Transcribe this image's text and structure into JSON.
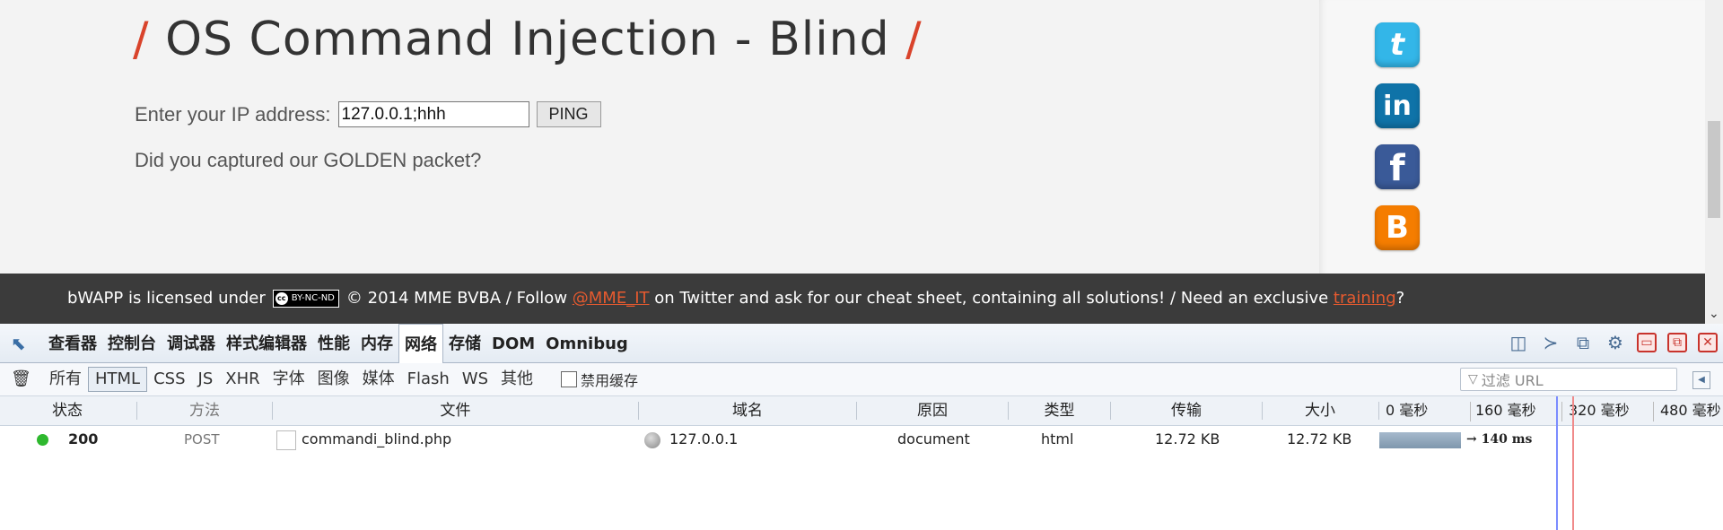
{
  "page": {
    "title": "OS Command Injection - Blind",
    "title_slash": "/",
    "ip_label": "Enter your IP address:",
    "ip_value": "127.0.0.1;hhh",
    "ping_label": "PING",
    "golden_message": "Did you captured our GOLDEN packet?"
  },
  "social": {
    "twitter": "t",
    "linkedin": "in",
    "facebook": "f",
    "blogger": "B"
  },
  "footer": {
    "prefix": "bWAPP is licensed under",
    "cc_badge": "BY-NC-ND",
    "cc_symbol": "cc",
    "middle": "© 2014 MME BVBA / Follow",
    "twitter_handle": "@MME_IT",
    "suffix": "on Twitter and ask for our cheat sheet, containing all solutions! / Need an exclusive",
    "training_link": "training",
    "end": "?"
  },
  "devtools": {
    "tabs": [
      "查看器",
      "控制台",
      "调试器",
      "样式编辑器",
      "性能",
      "内存",
      "网络",
      "存储",
      "DOM",
      "Omnibug"
    ],
    "active_tab": "网络",
    "type_filters": [
      "所有",
      "HTML",
      "CSS",
      "JS",
      "XHR",
      "字体",
      "图像",
      "媒体",
      "Flash",
      "WS",
      "其他"
    ],
    "active_filter": "HTML",
    "disable_cache_label": "禁用缓存",
    "url_filter_placeholder": "过滤 URL",
    "columns": {
      "status": "状态",
      "method": "方法",
      "file": "文件",
      "domain": "域名",
      "cause": "原因",
      "type": "类型",
      "transferred": "传输",
      "size": "大小"
    },
    "timeline_ticks": [
      "0 毫秒",
      "160 毫秒",
      "320 毫秒",
      "480 毫秒"
    ],
    "request": {
      "status": "200",
      "method": "POST",
      "file": "commandi_blind.php",
      "domain": "127.0.0.1",
      "cause": "document",
      "type": "html",
      "transferred": "12.72 KB",
      "size": "12.72 KB",
      "timing_ms": 140,
      "timing_label": "→ 140 ms"
    }
  },
  "colors": {
    "accent_red": "#d9432b",
    "footer_bg": "#3b3b3b",
    "link_orange": "#e65a2f",
    "status_green": "#2eb82e"
  }
}
